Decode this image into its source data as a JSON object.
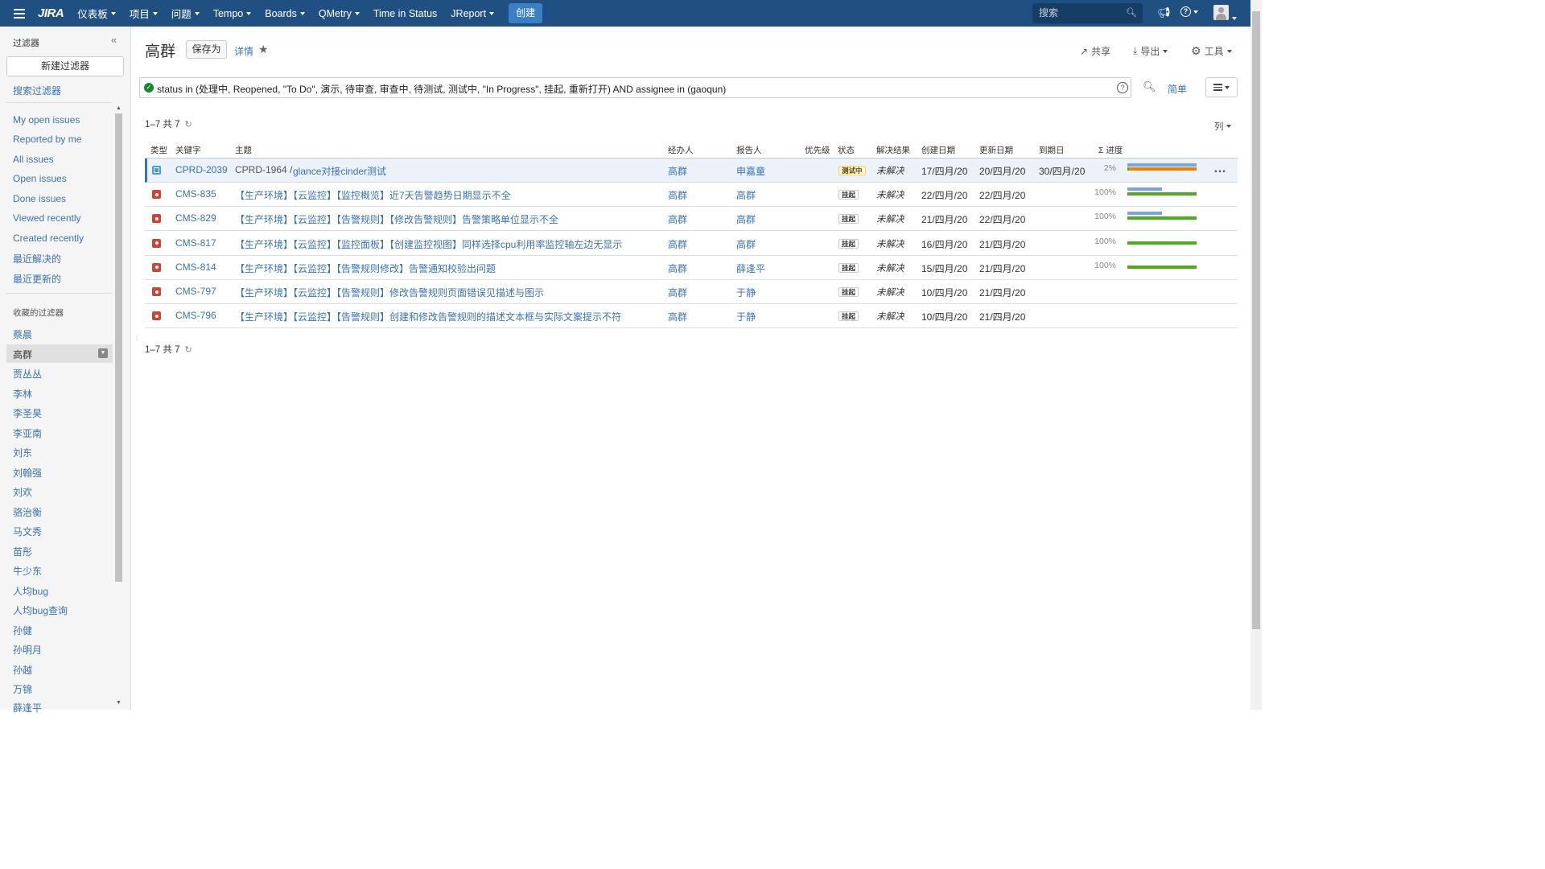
{
  "nav": {
    "logo": "JIRA",
    "items": [
      "仪表板",
      "项目",
      "问题",
      "Tempo",
      "Boards",
      "QMetry",
      "Time in Status",
      "JReport"
    ],
    "create": "创建",
    "search_placeholder": "搜索"
  },
  "sidebar": {
    "title": "过滤器",
    "new_filter": "新建过滤器",
    "search_filters": "搜索过滤器",
    "system_filters": [
      "My open issues",
      "Reported by me",
      "All issues",
      "Open issues",
      "Done issues",
      "Viewed recently",
      "Created recently",
      "最近解决的",
      "最近更新的"
    ],
    "favorites_title": "收藏的过滤器",
    "favorites": [
      "蔡晨",
      "高群",
      "贾丛丛",
      "李林",
      "李圣昊",
      "李亚南",
      "刘东",
      "刘翰强",
      "刘欢",
      "骆治衡",
      "马文秀",
      "苗彤",
      "牛少东",
      "人均bug",
      "人均bug查询",
      "孙健",
      "孙明月",
      "孙越",
      "万锦",
      "薛逢平"
    ],
    "active": "高群"
  },
  "header": {
    "title": "高群",
    "save_as": "保存为",
    "details": "详情",
    "share": "共享",
    "export": "导出",
    "tools": "工具"
  },
  "query": {
    "jql": "status in (处理中, Reopened, \"To Do\", 演示, 待审查, 审查中, 待测试, 测试中, \"In Progress\", 挂起, 重新打开) AND assignee in (gaoqun)",
    "simple": "简单"
  },
  "results": {
    "count_text": "1–7 共 7",
    "columns_btn": "列",
    "columns": [
      "类型",
      "关键字",
      "主题",
      "经办人",
      "报告人",
      "优先级",
      "状态",
      "解决结果",
      "创建日期",
      "更新日期",
      "到期日",
      "Σ 进度"
    ],
    "rows": [
      {
        "type": "subtask",
        "key": "CPRD-2039",
        "parent": "CPRD-1964 /",
        "summary": "glance对接cinder测试",
        "assignee": "高群",
        "reporter": "申嘉童",
        "status": "测试中",
        "resolution": "未解决",
        "created": "17/四月/20",
        "updated": "20/四月/20",
        "due": "30/四月/20",
        "progress": "2%",
        "progress_est": 1.0,
        "progress_done": 0.02
      },
      {
        "type": "bug",
        "key": "CMS-835",
        "parent": "",
        "summary": "【生产环境】【云监控】【监控概览】近7天告警趋势日期显示不全",
        "assignee": "高群",
        "reporter": "高群",
        "status": "挂起",
        "resolution": "未解决",
        "created": "22/四月/20",
        "updated": "22/四月/20",
        "due": "",
        "progress": "100%",
        "progress_est": 0.5,
        "progress_done": 1.0
      },
      {
        "type": "bug",
        "key": "CMS-829",
        "parent": "",
        "summary": "【生产环境】【云监控】【告警规则】【修改告警规则】告警策略单位显示不全",
        "assignee": "高群",
        "reporter": "高群",
        "status": "挂起",
        "resolution": "未解决",
        "created": "21/四月/20",
        "updated": "22/四月/20",
        "due": "",
        "progress": "100%",
        "progress_est": 0.5,
        "progress_done": 1.0
      },
      {
        "type": "bug",
        "key": "CMS-817",
        "parent": "",
        "summary": "【生产环境】【云监控】【监控面板】【创建监控视图】同样选择cpu利用率监控轴左边无显示",
        "assignee": "高群",
        "reporter": "高群",
        "status": "挂起",
        "resolution": "未解决",
        "created": "16/四月/20",
        "updated": "21/四月/20",
        "due": "",
        "progress": "100%",
        "progress_est": 0,
        "progress_done": 1.0
      },
      {
        "type": "bug",
        "key": "CMS-814",
        "parent": "",
        "summary": "【生产环境】【云监控】【告警规则修改】告警通知校验出问题",
        "assignee": "高群",
        "reporter": "薛逢平",
        "status": "挂起",
        "resolution": "未解决",
        "created": "15/四月/20",
        "updated": "21/四月/20",
        "due": "",
        "progress": "100%",
        "progress_est": 0,
        "progress_done": 1.0
      },
      {
        "type": "bug",
        "key": "CMS-797",
        "parent": "",
        "summary": "【生产环境】【云监控】【告警规则】修改告警规则页面错误见描述与图示",
        "assignee": "高群",
        "reporter": "于静",
        "status": "挂起",
        "resolution": "未解决",
        "created": "10/四月/20",
        "updated": "21/四月/20",
        "due": "",
        "progress": "",
        "progress_est": 0,
        "progress_done": 0
      },
      {
        "type": "bug",
        "key": "CMS-796",
        "parent": "",
        "summary": "【生产环境】【云监控】【告警规则】创建和修改告警规则的描述文本框与实际文案提示不符",
        "assignee": "高群",
        "reporter": "于静",
        "status": "挂起",
        "resolution": "未解决",
        "created": "10/四月/20",
        "updated": "21/四月/20",
        "due": "",
        "progress": "",
        "progress_est": 0,
        "progress_done": 0
      }
    ]
  },
  "colors": {
    "nav_bg": "#205081",
    "link": "#3b73af",
    "bug": "#d04437",
    "subtask": "#4a9ae1",
    "progress_done": "#51a825",
    "progress_est": "#7aa3d8"
  }
}
